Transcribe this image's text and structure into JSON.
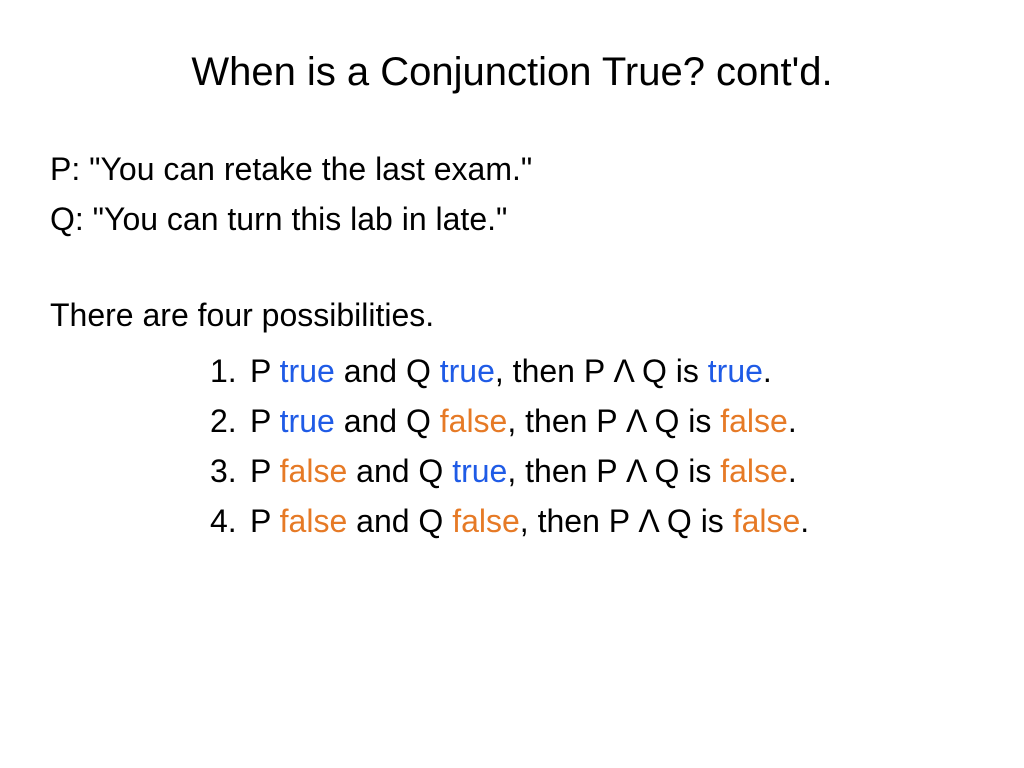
{
  "title": "When is a Conjunction True? cont'd.",
  "propositions": {
    "p": {
      "label": "P:",
      "text": "\"You can retake the last exam.\""
    },
    "q": {
      "label": "Q:",
      "text": " \"You can turn this lab in late.\""
    }
  },
  "intro": "There are four possibilities.",
  "possibilities": [
    {
      "num": "1.",
      "parts": {
        "a": "P ",
        "p_val": "true",
        "b": " and Q ",
        "q_val": "true",
        "c": ", then P Λ Q is ",
        "r_val": "true",
        "d": "."
      },
      "p_class": "tv-true",
      "q_class": "tv-true",
      "r_class": "tv-true"
    },
    {
      "num": "2.",
      "parts": {
        "a": "P ",
        "p_val": "true",
        "b": " and Q ",
        "q_val": "false",
        "c": ", then P Λ Q is ",
        "r_val": "false",
        "d": "."
      },
      "p_class": "tv-true",
      "q_class": "tv-false",
      "r_class": "tv-false"
    },
    {
      "num": "3.",
      "parts": {
        "a": "P ",
        "p_val": "false",
        "b": " and Q ",
        "q_val": "true",
        "c": ", then P Λ Q is ",
        "r_val": "false",
        "d": "."
      },
      "p_class": "tv-false",
      "q_class": "tv-true",
      "r_class": "tv-false"
    },
    {
      "num": "4.",
      "parts": {
        "a": "P ",
        "p_val": "false",
        "b": " and Q ",
        "q_val": "false",
        "c": ", then P Λ Q is ",
        "r_val": "false",
        "d": "."
      },
      "p_class": "tv-false",
      "q_class": "tv-false",
      "r_class": "tv-false"
    }
  ]
}
